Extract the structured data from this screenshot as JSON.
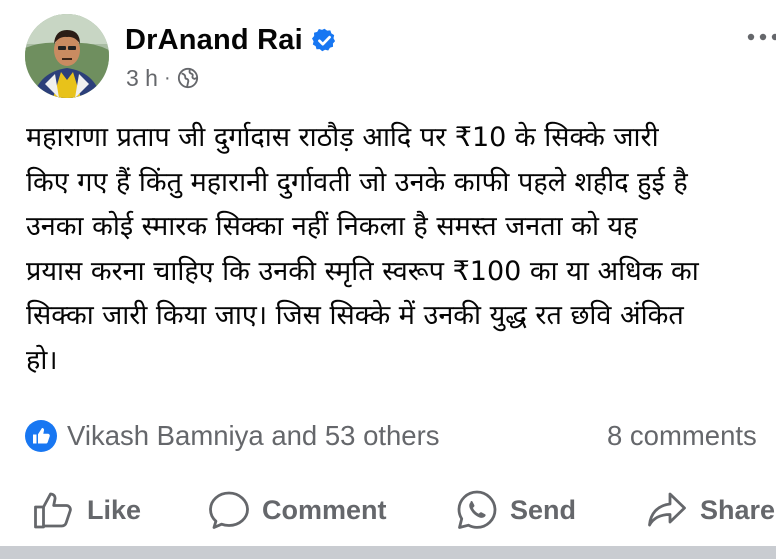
{
  "post": {
    "author": "DrAnand Rai",
    "verified": true,
    "time": "3 h",
    "separator": "·",
    "audience_icon": "globe-icon",
    "more_icon": "more-horizontal-icon",
    "text_lines": [
      "महाराणा प्रताप जी दुर्गादास राठौड़ आदि पर ₹10 के सिक्के जारी",
      "किए गए हैं किंतु महारानी दुर्गावती जो उनके काफी पहले शहीद हुई है",
      "उनका कोई स्मारक सिक्का नहीं निकला है समस्त जनता को यह",
      "प्रयास करना चाहिए कि उनकी स्मृति स्वरूप ₹100 का या अधिक का",
      "सिक्का जारी किया जाए। जिस सिक्के में उनकी युद्ध रत छवि अंकित",
      "हो।"
    ]
  },
  "engagement": {
    "reactions": "Vikash Bamniya and 53 others",
    "comments": "8 comments"
  },
  "actions": {
    "like": "Like",
    "comment": "Comment",
    "send": "Send",
    "share": "Share"
  },
  "colors": {
    "primary_text": "#050505",
    "secondary_text": "#65676b",
    "facebook_blue": "#1877f2",
    "divider": "#c9ccd1"
  }
}
